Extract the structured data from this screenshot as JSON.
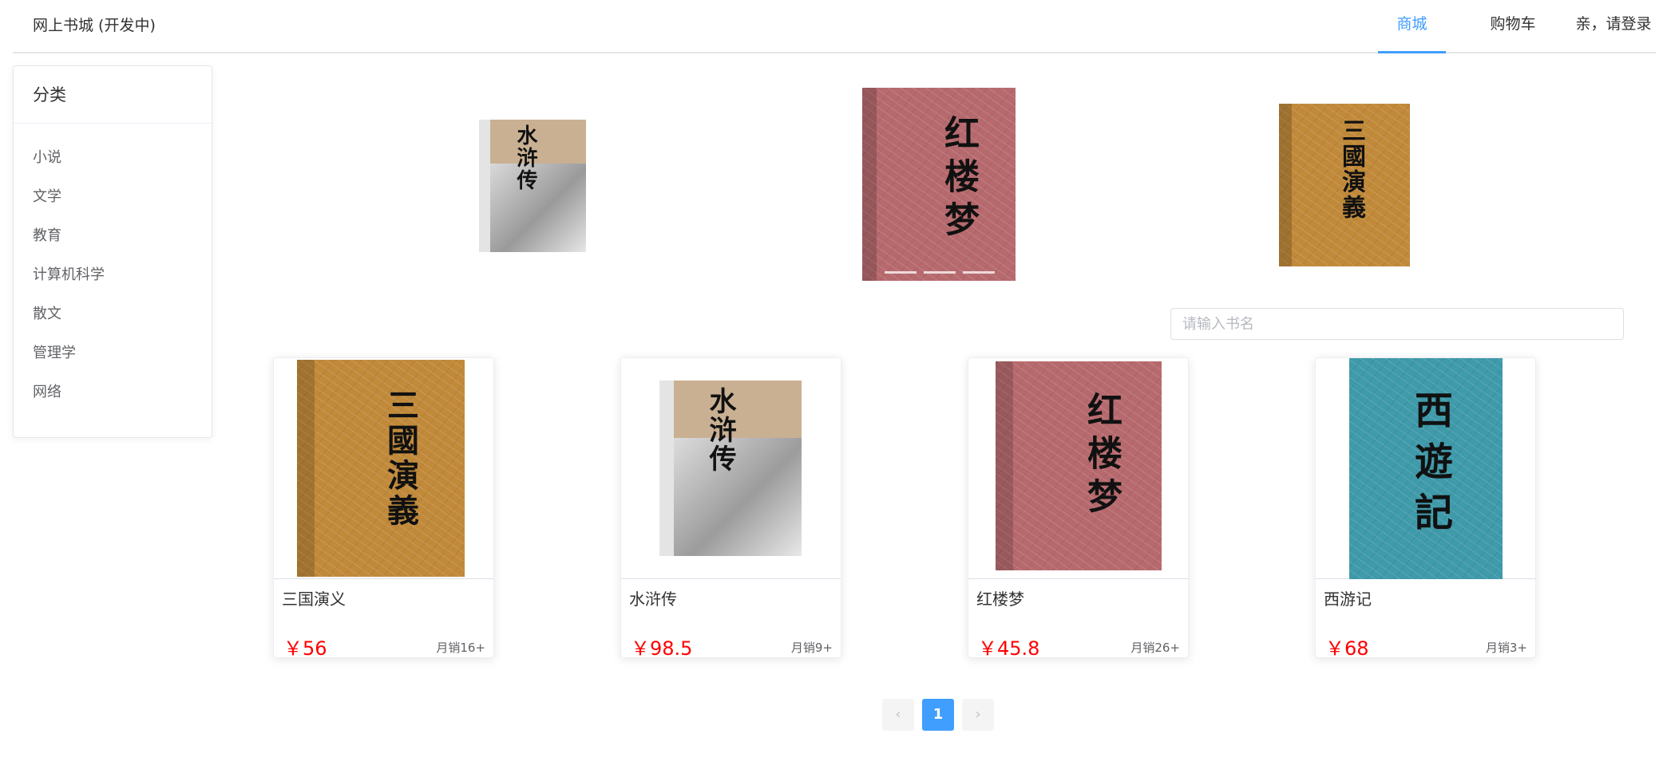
{
  "header": {
    "brand": "网上书城 (开发中)",
    "nav": {
      "store": "商城",
      "cart": "购物车",
      "login": "亲，请登录"
    }
  },
  "sidebar": {
    "title": "分类",
    "categories": [
      "小说",
      "文学",
      "教育",
      "计算机科学",
      "散文",
      "管理学",
      "网络"
    ]
  },
  "carousel": {
    "slides": [
      {
        "cover_title": "水浒传",
        "cover_color": "#c9b093"
      },
      {
        "cover_title": "红楼梦",
        "cover_color": "#b76a6e"
      },
      {
        "cover_title": "三國演義",
        "cover_color": "#c18a3a"
      }
    ],
    "active_index": 1
  },
  "search": {
    "placeholder": "请输入书名",
    "value": ""
  },
  "products": [
    {
      "name": "三国演义",
      "price": "￥56",
      "sales": "月销16+",
      "cover_title": "三國演義",
      "cover_color": "#c18a3a"
    },
    {
      "name": "水浒传",
      "price": "￥98.5",
      "sales": "月销9+",
      "cover_title": "水浒传",
      "cover_color": "#c9b093"
    },
    {
      "name": "红楼梦",
      "price": "￥45.8",
      "sales": "月销26+",
      "cover_title": "红楼梦",
      "cover_color": "#b76a6e"
    },
    {
      "name": "西游记",
      "price": "￥68",
      "sales": "月销3+",
      "cover_title": "西遊記",
      "cover_color": "#3f9aaa"
    }
  ],
  "pagination": {
    "prev": "‹",
    "current": "1",
    "next": "›"
  },
  "colors": {
    "accent": "#409eff",
    "price": "#ff0000"
  }
}
